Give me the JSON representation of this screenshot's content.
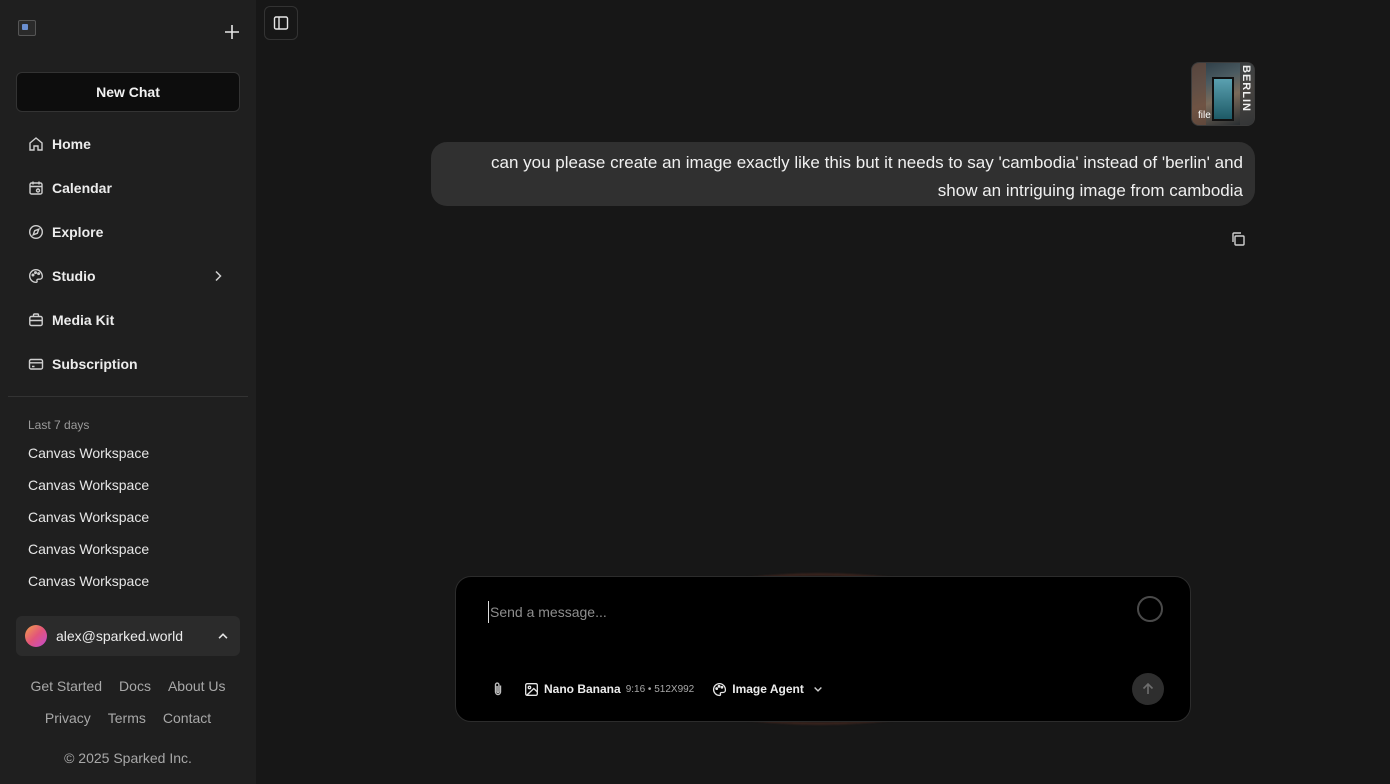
{
  "sidebar": {
    "new_chat_label": "New Chat",
    "nav": [
      {
        "label": "Home",
        "icon": "home-icon"
      },
      {
        "label": "Calendar",
        "icon": "calendar-icon"
      },
      {
        "label": "Explore",
        "icon": "compass-icon"
      },
      {
        "label": "Studio",
        "icon": "palette-icon"
      },
      {
        "label": "Media Kit",
        "icon": "briefcase-icon"
      },
      {
        "label": "Subscription",
        "icon": "credit-card-icon"
      }
    ],
    "section_label": "Last 7 days",
    "history": [
      "Canvas Workspace",
      "Canvas Workspace",
      "Canvas Workspace",
      "Canvas Workspace",
      "Canvas Workspace"
    ],
    "user_email": "alex@sparked.world",
    "footer_links": [
      "Get Started",
      "Docs",
      "About Us",
      "Privacy",
      "Terms",
      "Contact"
    ],
    "copyright": "© 2025 Sparked Inc."
  },
  "chat": {
    "attachment": {
      "tag": "file",
      "image_text": "BERLIN"
    },
    "message": "can you please create an image exactly like this but it needs to say 'cambodia' instead of 'berlin' and show an intriguing image from cambodia"
  },
  "composer": {
    "placeholder": "Send a message...",
    "model_name": "Nano Banana",
    "model_meta": "9:16 • 512X992",
    "agent_name": "Image Agent"
  },
  "colors": {
    "background": "#171717",
    "sidebar": "#1f1f1f",
    "bubble": "#303030",
    "composer": "#000000",
    "accent_glow": "#be5032"
  }
}
